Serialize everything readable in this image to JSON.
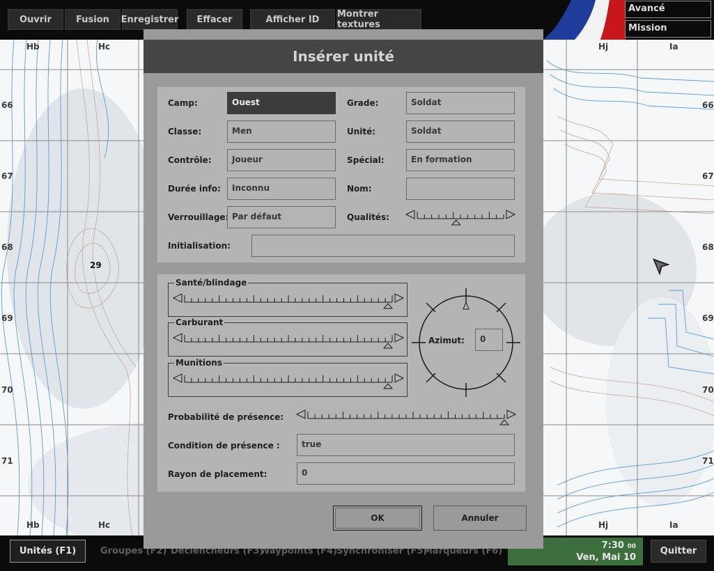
{
  "toolbar": {
    "open": "Ouvrir",
    "merge": "Fusion",
    "save": "Enregistrer",
    "clear": "Effacer",
    "show_id": "Afficher ID",
    "show_textures": "Montrer textures"
  },
  "modes": {
    "advanced": "Avancé",
    "mission": "Mission"
  },
  "map": {
    "columns": [
      "Hb",
      "Hc",
      "Hj",
      "Ia"
    ],
    "rows": [
      "66",
      "67",
      "68",
      "69",
      "70",
      "71"
    ],
    "elevation_label": "29",
    "cursor_icon": "arrow-cursor-icon"
  },
  "dialog": {
    "title": "Insérer unité",
    "fields": {
      "side_label": "Camp:",
      "side_value": "Ouest",
      "class_label": "Classe:",
      "class_value": "Men",
      "control_label": "Contrôle:",
      "control_value": "Joueur",
      "info_age_label": "Durée info:",
      "info_age_value": "Inconnu",
      "lock_label": "Verrouillage:",
      "lock_value": "Par défaut",
      "rank_label": "Grade:",
      "rank_value": "Soldat",
      "unit_label": "Unité:",
      "unit_value": "Soldat",
      "special_label": "Spécial:",
      "special_value": "En formation",
      "name_label": "Nom:",
      "name_value": "",
      "skill_label": "Qualités:",
      "init_label": "Initialisation:",
      "init_value": ""
    },
    "sliders": {
      "health_label": "Santé/blindage",
      "fuel_label": "Carburant",
      "ammo_label": "Munitions",
      "health_level": 0.98,
      "fuel_level": 0.98,
      "ammo_level": 0.98,
      "skill_level": 0.45,
      "presence_level": 1.0
    },
    "azimuth": {
      "label": "Azimut:",
      "value": "0"
    },
    "presence": {
      "probability_label": "Probabilité de présence:",
      "condition_label": "Condition de présence :",
      "condition_value": "true",
      "radius_label": "Rayon de placement:",
      "radius_value": "0"
    },
    "ok": "OK",
    "cancel": "Annuler"
  },
  "bottombar": {
    "units": "Unités (F1)",
    "groups": "Groupes (F2)",
    "triggers": "Déclencheurs (F3)",
    "waypoints": "Waypoints (F4)",
    "sync": "Synchroniser (F5)",
    "markers": "Marqueurs (F6)",
    "time": "7:30",
    "seconds": "00",
    "date": "Ven, Mai 10",
    "quit": "Quitter"
  },
  "colors": {
    "toolbar_bg": "#0b0b0b",
    "dialog_bg": "#9a9a9a",
    "panel_bg": "#b4b4b4",
    "title_bar": "#454545",
    "selected_field": "#3c3c3c",
    "clock_bg": "#3d6e3d"
  }
}
